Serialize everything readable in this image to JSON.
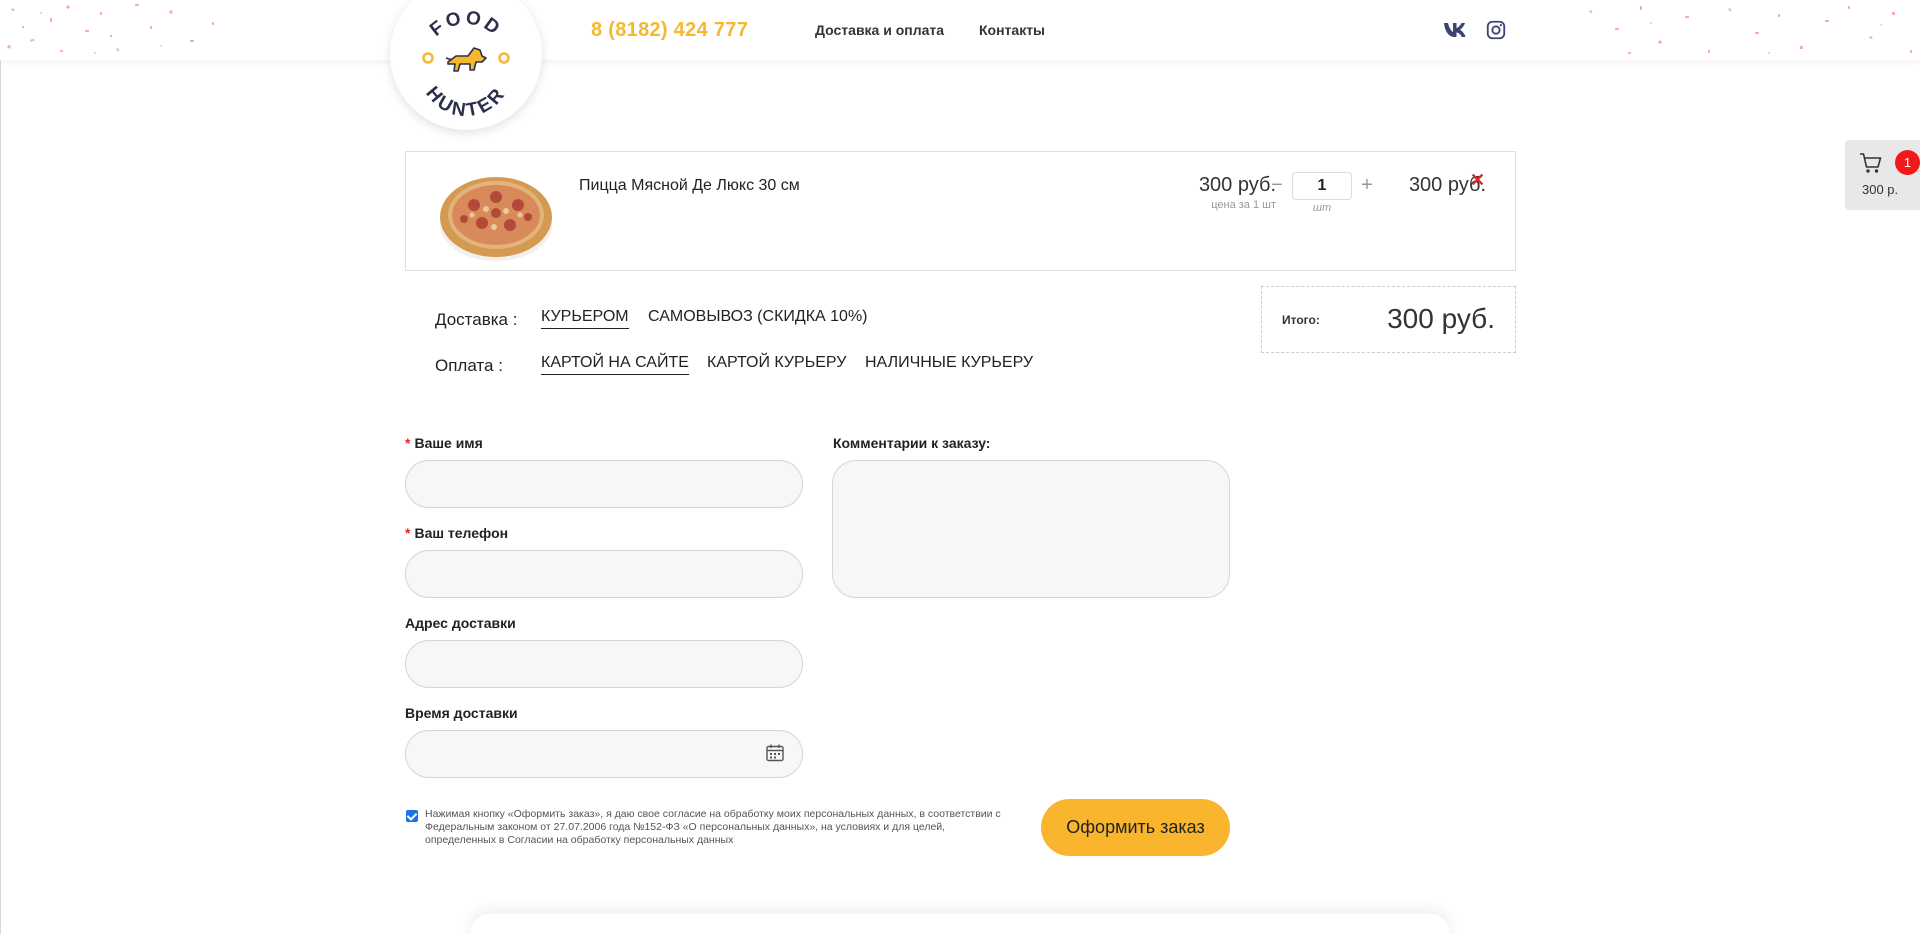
{
  "header": {
    "logo_top": "FOOD",
    "logo_bottom": "HUNTER",
    "phone": "8 (8182) 424 777",
    "nav": {
      "delivery": "Доставка и оплата",
      "contacts": "Контакты"
    },
    "social": [
      "vk-icon",
      "instagram-icon"
    ]
  },
  "cart_widget": {
    "count": "1",
    "sum": "300 р."
  },
  "cart": {
    "items": [
      {
        "name": "Пицца Мясной Де Люкс 30 см",
        "price": "300 руб.",
        "price_note": "цена за 1 шт",
        "quantity": "1",
        "unit": "шт",
        "total": "300 руб."
      }
    ]
  },
  "delivery": {
    "label": "Доставка :",
    "options": [
      "КУРЬЕРОМ",
      "САМОВЫВОЗ (СКИДКА 10%)"
    ],
    "selected": "КУРЬЕРОМ"
  },
  "payment": {
    "label": "Оплата :",
    "options": [
      "КАРТОЙ НА САЙТЕ",
      "КАРТОЙ КУРЬЕРУ",
      "НАЛИЧНЫЕ КУРЬЕРУ"
    ],
    "selected": "КАРТОЙ НА САЙТЕ"
  },
  "total": {
    "label": "Итого:",
    "value": "300 руб."
  },
  "form": {
    "required_mark": "*",
    "name_label": "Ваше имя",
    "name_value": "",
    "phone_label": "Ваш телефон",
    "phone_value": "",
    "address_label": "Адрес доставки",
    "address_value": "",
    "time_label": "Время доставки",
    "time_value": "",
    "comment_label": "Комментарии к заказу:",
    "comment_value": ""
  },
  "consent": {
    "checked": true,
    "text": "Нажимая кнопку «Оформить заказ», я даю свое согласие на обработку моих персональных данных, в соответствии с Федеральным законом от 27.07.2006 года №152-ФЗ «О персональных данных», на условиях и для целей, определенных в Согласии на обработку персональных данных"
  },
  "submit_label": "Оформить заказ",
  "colors": {
    "accent": "#f9b52d",
    "phone": "#f5b82e",
    "badge": "#f01a1a",
    "remove": "#e3262b",
    "checkbox": "#1a73e8"
  }
}
